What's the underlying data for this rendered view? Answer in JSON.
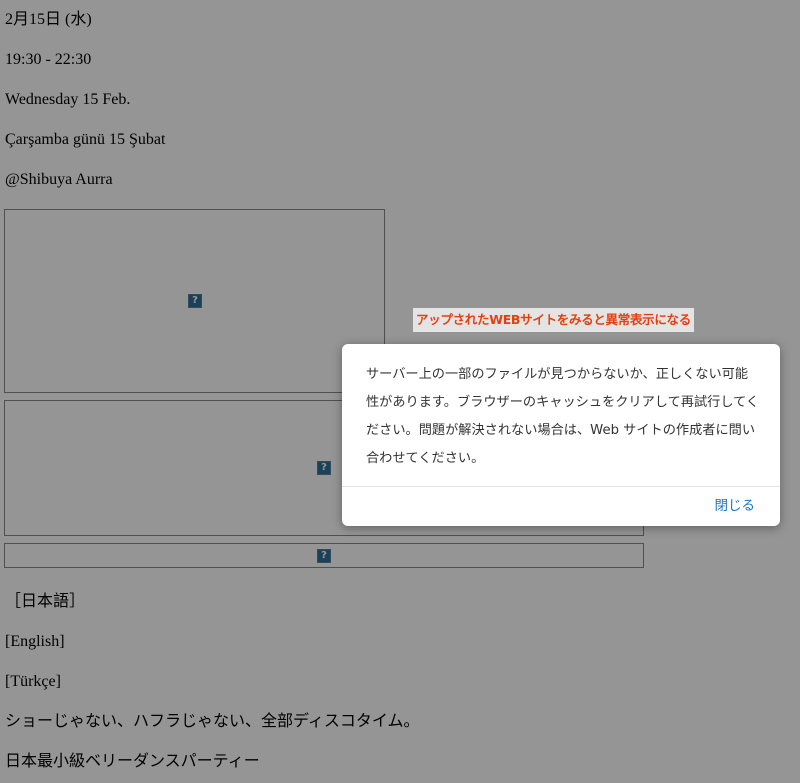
{
  "page": {
    "date_jp": "2月15日 (水)",
    "time": "19:30 - 22:30",
    "date_en": "Wednesday 15 Feb.",
    "date_tr": "Çarşamba günü 15 Şubat",
    "venue": "@Shibuya Aurra",
    "broken_image_glyph": "?",
    "lang_jp": "［日本語］",
    "lang_en": "[English]",
    "lang_tr": "[Türkçe]",
    "tagline": "ショーじゃない、ハフラじゃない、全部ディスコタイム。",
    "subtitle": "日本最小級ベリーダンスパーティー"
  },
  "annotation": {
    "text": "アップされたWEBサイトをみると異常表示になる",
    "color": "#e4400f"
  },
  "dialog": {
    "message": "サーバー上の一部のファイルが見つからないか、正しくない可能性があります。ブラウザーのキャッシュをクリアして再試行してください。問題が解決されない場合は、Web サイトの作成者に問い合わせてください。",
    "close_label": "閉じる",
    "accent": "#1a73c7"
  }
}
